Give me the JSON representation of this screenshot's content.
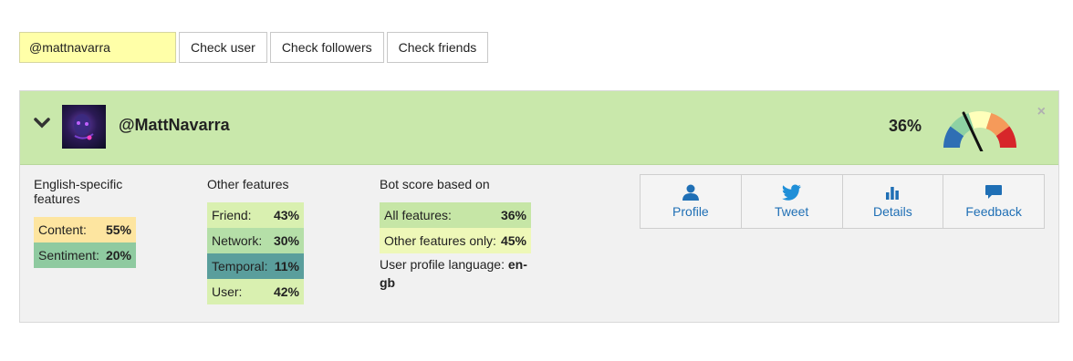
{
  "search": {
    "value": "@mattnavarra"
  },
  "buttons": {
    "check_user": "Check user",
    "check_followers": "Check followers",
    "check_friends": "Check friends"
  },
  "header": {
    "username": "@MattNavarra",
    "score": "36%",
    "close": "×"
  },
  "english_features": {
    "title": "English-specific features",
    "items": [
      {
        "label": "Content:",
        "value": "55%",
        "color": "#fde5a0"
      },
      {
        "label": "Sentiment:",
        "value": "20%",
        "color": "#8fcaa0"
      }
    ]
  },
  "other_features": {
    "title": "Other features",
    "items": [
      {
        "label": "Friend:",
        "value": "43%",
        "color": "#d9f0b0"
      },
      {
        "label": "Network:",
        "value": "30%",
        "color": "#b5dfa8"
      },
      {
        "label": "Temporal:",
        "value": "11%",
        "color": "#5a9e9c"
      },
      {
        "label": "User:",
        "value": "42%",
        "color": "#d9f0b0"
      }
    ]
  },
  "bot_score": {
    "title": "Bot score based on",
    "items": [
      {
        "label": "All features:",
        "value": "36%",
        "color": "#c6e6a6"
      },
      {
        "label": "Other features only:",
        "value": "45%",
        "color": "#eef8b8"
      }
    ],
    "language_label": "User profile language:",
    "language_value": "en-gb"
  },
  "actions": [
    {
      "label": "Profile",
      "icon": "person-icon"
    },
    {
      "label": "Tweet",
      "icon": "bird-icon"
    },
    {
      "label": "Details",
      "icon": "bar-chart-icon"
    },
    {
      "label": "Feedback",
      "icon": "speech-bubble-icon"
    }
  ],
  "gauge": {
    "value": 0.36,
    "colors": [
      "#2f6fb4",
      "#8ed1a3",
      "#ffffbb",
      "#f59a5a",
      "#d7262a"
    ]
  }
}
